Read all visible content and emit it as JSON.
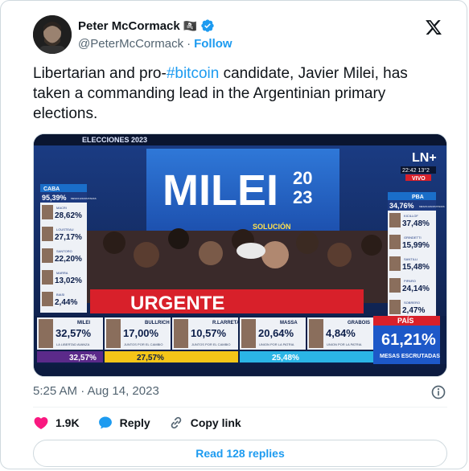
{
  "author": {
    "name": "Peter McCormack",
    "name_emoji": "🏴‍☠️",
    "handle": "@PeterMcCormack",
    "separator": "·",
    "follow_label": "Follow"
  },
  "tweet": {
    "text_before": "Libertarian and pro-",
    "hashtag": "#bitcoin",
    "text_after": " candidate, Javier Milei, has taken a commanding lead in the Argentinian primary elections."
  },
  "media": {
    "top_banner": "ELECCIONES 2023",
    "stage_sign": "MILEI",
    "stage_year_top": "20",
    "stage_year_bottom": "23",
    "stage_sub": "SOLUCIÓN",
    "urgente": "URGENTE",
    "channel_logo": "LN+",
    "clock": "22:42 13°2",
    "vivo": "VIVO",
    "caba": {
      "title": "CABA",
      "mesas_pct": "95,39%",
      "mesas_label": "MESAS ESCRUTADAS",
      "rows": [
        {
          "name": "MACRI",
          "value": "28,62%"
        },
        {
          "name": "LOUSTEAU",
          "value": "27,17%"
        },
        {
          "name": "SANTORO",
          "value": "22,20%"
        },
        {
          "name": "MARRA",
          "value": "13,02%"
        },
        {
          "name": "BIASI",
          "value": "2,44%"
        }
      ]
    },
    "pba": {
      "title": "PBA",
      "mesas_pct": "34,76%",
      "mesas_label": "MESAS ESCRUTADAS",
      "rows": [
        {
          "name": "KICILLOF",
          "value": "37,48%"
        },
        {
          "name": "GRINDETTI",
          "value": "15,99%"
        },
        {
          "name": "SANTILLI",
          "value": "15,48%"
        },
        {
          "name": "PIPARO",
          "value": "24,14%"
        },
        {
          "name": "SOBRERO",
          "value": "2,47%"
        }
      ]
    },
    "national": {
      "candidates": [
        {
          "name": "MILEI",
          "value": "32,57%",
          "party": "LA LIBERTAD AVANZA",
          "total": "32,57%"
        },
        {
          "name": "BULLRICH",
          "value": "17,00%",
          "party": "JUNTOS POR EL CAMBIO",
          "total": "27,57%"
        },
        {
          "name": "R.LARRETA",
          "value": "10,57%",
          "party": "JUNTOS POR EL CAMBIO",
          "total": ""
        },
        {
          "name": "MASSA",
          "value": "20,64%",
          "party": "UNION POR LA PATRIA",
          "total": "25,48%"
        },
        {
          "name": "GRABOIS",
          "value": "4,84%",
          "party": "UNION POR LA PATRIA",
          "total": ""
        }
      ],
      "pais_label": "PAÍS",
      "pais_value": "61,21%",
      "pais_sub": "MESAS ESCRUTADAS"
    }
  },
  "timestamp": "5:25 AM · Aug 14, 2023",
  "actions": {
    "like_count": "1.9K",
    "reply_label": "Reply",
    "copy_label": "Copy link"
  },
  "read_replies": "Read 128 replies",
  "colors": {
    "accent": "#1d9bf0",
    "like": "#f91880",
    "muted": "#536471"
  }
}
